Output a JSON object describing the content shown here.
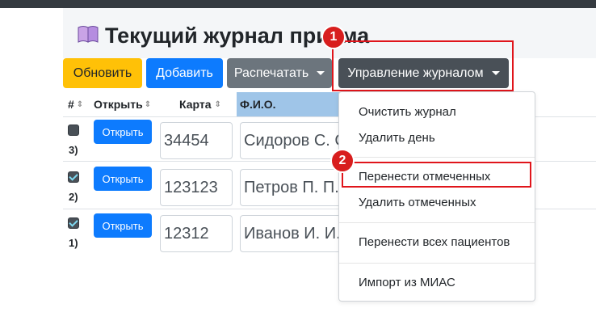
{
  "page_title": "Текущий журнал приема",
  "icons": {
    "title": "book-icon"
  },
  "colors": {
    "warning": "#ffc107",
    "primary": "#0d7bfe",
    "secondary": "#6c757d",
    "dark": "#495057",
    "annotation": "#e0151b"
  },
  "toolbar": {
    "refresh": "Обновить",
    "add": "Добавить",
    "print": "Распечатать",
    "manage": "Управление журналом"
  },
  "table": {
    "headers": {
      "num": "#",
      "open": "Открыть",
      "card": "Карта",
      "fio": "Ф.И.О."
    },
    "rows": [
      {
        "checked": false,
        "num": "3)",
        "open": "Открыть",
        "card": "34454",
        "fio": "Сидоров С. С"
      },
      {
        "checked": true,
        "num": "2)",
        "open": "Открыть",
        "card": "123123",
        "fio": "Петров П. П."
      },
      {
        "checked": true,
        "num": "1)",
        "open": "Открыть",
        "card": "12312",
        "fio": "Иванов И. И."
      }
    ]
  },
  "menu": {
    "items": [
      "Очистить журнал",
      "Удалить день",
      "Перенести отмеченных",
      "Удалить отмеченных",
      "Перенести всех пациентов",
      "Импорт из МИАС"
    ]
  },
  "annotations": {
    "step1": "1",
    "step2": "2"
  }
}
